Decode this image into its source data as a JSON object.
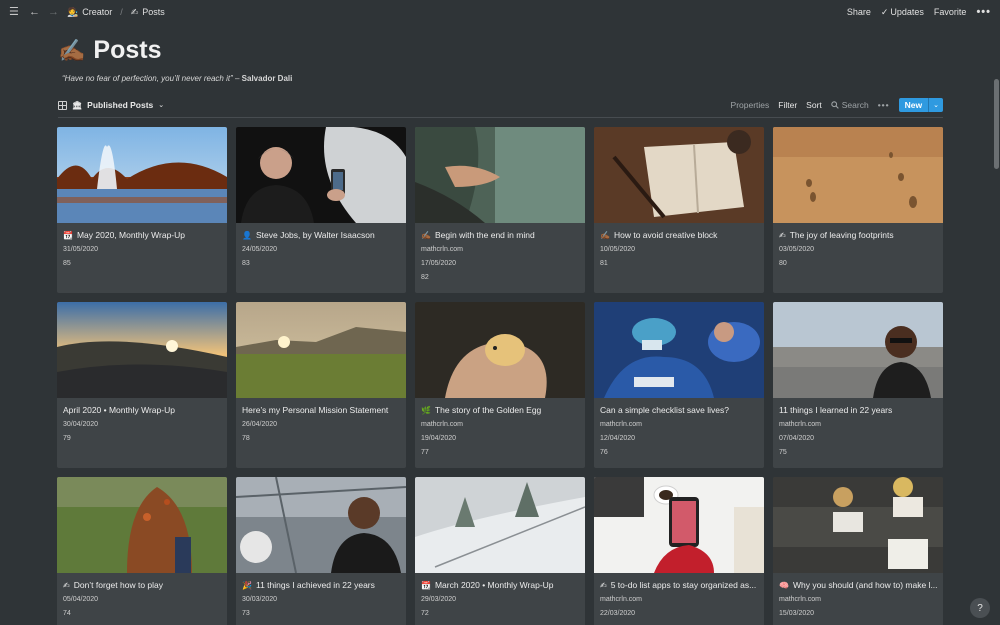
{
  "topbar": {
    "workspace": "Creator",
    "workspace_icon": "🧑‍🎨",
    "page": "Posts",
    "page_icon": "✍",
    "share": "Share",
    "updates": "Updates",
    "favorite": "Favorite",
    "more": "•••"
  },
  "header": {
    "emoji": "✍🏾",
    "title": "Posts",
    "quote": "“Have no fear of perfection, you’ll never reach it”",
    "quote_sep": " – ",
    "quote_author": "Salvador Dali"
  },
  "viewbar": {
    "view_icon": "🏛",
    "view_name": "Published Posts",
    "properties": "Properties",
    "filter": "Filter",
    "sort": "Sort",
    "search": "Search",
    "more": "•••",
    "new": "New"
  },
  "cards": [
    {
      "emoji": "📆",
      "title": "May 2020, Monthly Wrap-Up",
      "props": [
        "31/05/2020",
        "85"
      ]
    },
    {
      "emoji": "👤",
      "title": "Steve Jobs, by Walter Isaacson",
      "props": [
        "24/05/2020",
        "83"
      ]
    },
    {
      "emoji": "✍🏾",
      "title": "Begin with the end in mind",
      "props": [
        "mathcrln.com",
        "17/05/2020",
        "82"
      ]
    },
    {
      "emoji": "✍🏾",
      "title": "How to avoid creative block",
      "props": [
        "10/05/2020",
        "81"
      ]
    },
    {
      "emoji": "✍",
      "title": "The joy of leaving footprints",
      "props": [
        "03/05/2020",
        "80"
      ]
    },
    {
      "emoji": "",
      "title": "April 2020 • Monthly Wrap-Up",
      "props": [
        "30/04/2020",
        "79"
      ]
    },
    {
      "emoji": "",
      "title": "Here’s my Personal Mission Statement",
      "props": [
        "26/04/2020",
        "78"
      ]
    },
    {
      "emoji": "🌿",
      "title": "The story of the Golden Egg",
      "props": [
        "mathcrln.com",
        "19/04/2020",
        "77"
      ]
    },
    {
      "emoji": "",
      "title": "Can a simple checklist save lives?",
      "props": [
        "mathcrln.com",
        "12/04/2020",
        "76"
      ]
    },
    {
      "emoji": "",
      "title": "11 things I learned in 22 years",
      "props": [
        "mathcrln.com",
        "07/04/2020",
        "75"
      ]
    },
    {
      "emoji": "✍",
      "title": "Don’t forget how to play",
      "props": [
        "05/04/2020",
        "74"
      ]
    },
    {
      "emoji": "🎉",
      "title": "11 things I achieved in 22 years",
      "props": [
        "30/03/2020",
        "73"
      ]
    },
    {
      "emoji": "📆",
      "title": "March 2020 • Monthly Wrap-Up",
      "props": [
        "29/03/2020",
        "72"
      ]
    },
    {
      "emoji": "✍",
      "title": "5 to-do list apps to stay organized as...",
      "props": [
        "mathcrln.com",
        "22/03/2020"
      ]
    },
    {
      "emoji": "🧠",
      "title": "Why you should (and how to) make l...",
      "props": [
        "mathcrln.com",
        "15/03/2020"
      ]
    }
  ],
  "help": "?"
}
